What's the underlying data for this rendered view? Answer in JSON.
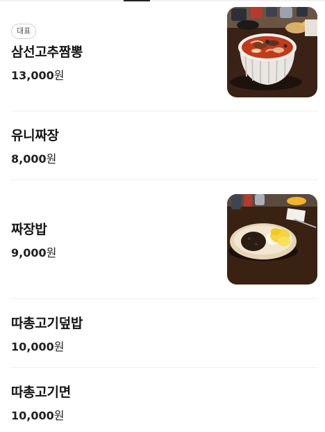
{
  "menu": {
    "items": [
      {
        "badge": "대표",
        "name": "삼선고추짬뽕",
        "price": "13,000",
        "currency": "원",
        "image_icon": "jjamppong-photo"
      },
      {
        "name": "유니짜장",
        "price": "8,000",
        "currency": "원"
      },
      {
        "name": "짜장밥",
        "price": "9,000",
        "currency": "원",
        "image_icon": "jjajangbap-photo"
      },
      {
        "name": "따총고기덮밥",
        "price": "10,000",
        "currency": "원"
      },
      {
        "name": "따총고기면",
        "price": "10,000",
        "currency": "원"
      }
    ]
  }
}
